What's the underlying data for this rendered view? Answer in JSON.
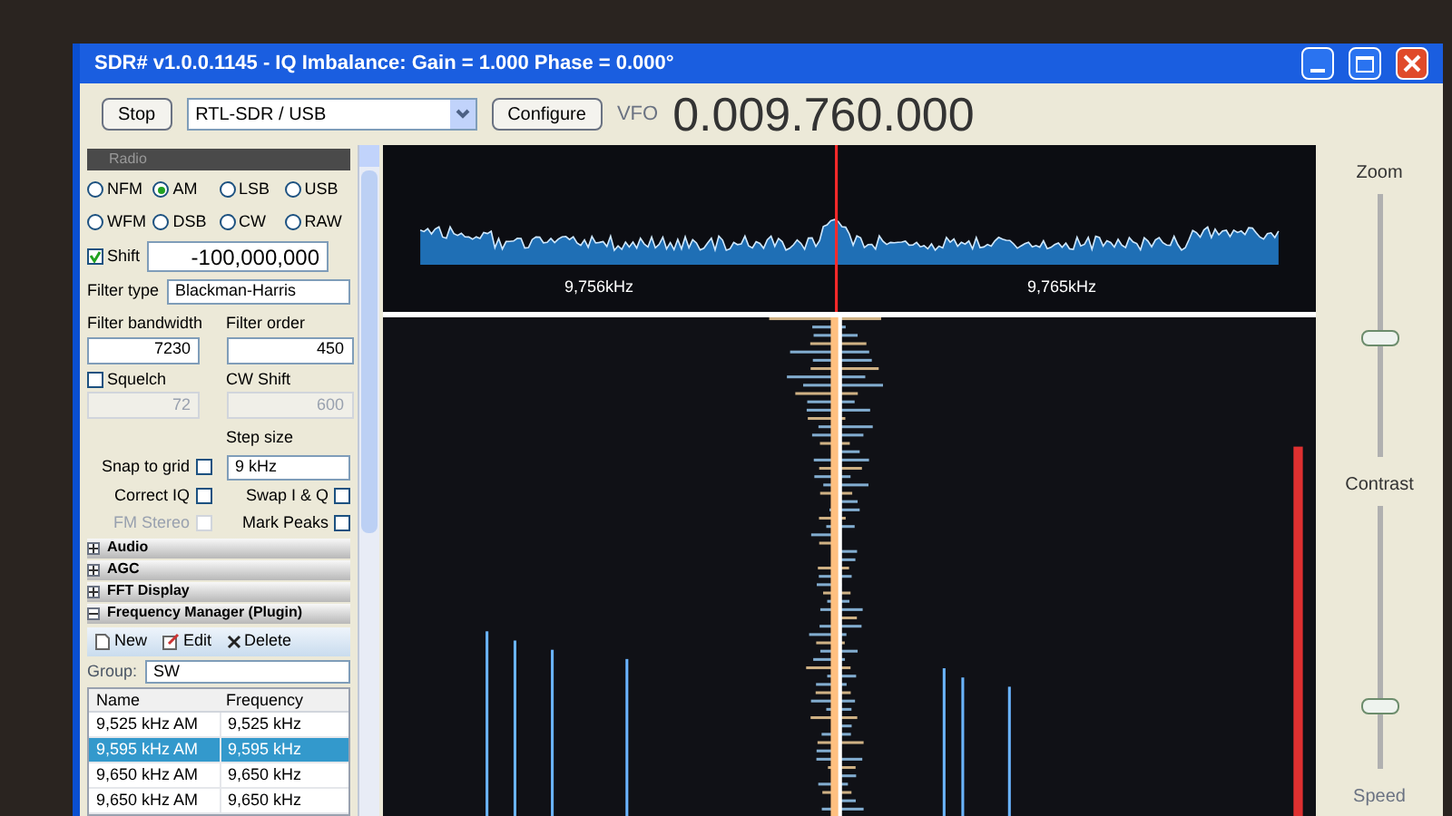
{
  "window": {
    "title": "SDR# v1.0.0.1145 - IQ Imbalance: Gain = 1.000 Phase = 0.000°"
  },
  "toolbar": {
    "start_stop": "Stop",
    "device": "RTL-SDR / USB",
    "configure": "Configure",
    "vfo_label": "VFO",
    "frequency": "0.009.760.000"
  },
  "radio": {
    "title": "Radio",
    "modes": [
      {
        "label": "NFM",
        "selected": false
      },
      {
        "label": "AM",
        "selected": true
      },
      {
        "label": "LSB",
        "selected": false
      },
      {
        "label": "USB",
        "selected": false
      },
      {
        "label": "WFM",
        "selected": false
      },
      {
        "label": "DSB",
        "selected": false
      },
      {
        "label": "CW",
        "selected": false
      },
      {
        "label": "RAW",
        "selected": false
      }
    ],
    "shift": {
      "label": "Shift",
      "checked": true,
      "value": "-100,000,000"
    },
    "filter_type": {
      "label": "Filter type",
      "value": "Blackman-Harris"
    },
    "filter_bandwidth": {
      "label": "Filter bandwidth",
      "value": "7230"
    },
    "filter_order": {
      "label": "Filter order",
      "value": "450"
    },
    "squelch": {
      "label": "Squelch",
      "checked": false,
      "value": "72"
    },
    "cw_shift": {
      "label": "CW Shift",
      "value": "600"
    },
    "step_size": {
      "label": "Step size",
      "value": "9 kHz"
    },
    "options": [
      {
        "label": "Snap to grid",
        "checked": false,
        "disabled": false
      },
      {
        "label": "Correct IQ",
        "checked": false,
        "disabled": false
      },
      {
        "label": "Swap I & Q",
        "checked": false,
        "disabled": false
      },
      {
        "label": "FM Stereo",
        "checked": false,
        "disabled": true
      },
      {
        "label": "Mark Peaks",
        "checked": false,
        "disabled": false
      }
    ]
  },
  "sections": [
    {
      "label": "Audio",
      "expanded": false
    },
    {
      "label": "AGC",
      "expanded": false
    },
    {
      "label": "FFT Display",
      "expanded": false
    },
    {
      "label": "Frequency Manager (Plugin)",
      "expanded": true
    }
  ],
  "frequency_manager": {
    "actions": [
      "New",
      "Edit",
      "Delete"
    ],
    "group_label": "Group:",
    "group": "SW",
    "columns": [
      "Name",
      "Frequency"
    ],
    "rows": [
      {
        "name": "9,525 kHz AM",
        "frequency": "9,525 kHz",
        "selected": false
      },
      {
        "name": "9,595 kHz AM",
        "frequency": "9,595 kHz",
        "selected": true
      },
      {
        "name": "9,650 kHz AM",
        "frequency": "9,650 kHz",
        "selected": false
      },
      {
        "name": "9,650 kHz AM",
        "frequency": "9,650 kHz",
        "selected": false
      }
    ]
  },
  "spectrum": {
    "freq_labels": [
      "9,756kHz",
      "9,765kHz"
    ]
  },
  "sliders": [
    {
      "label": "Zoom",
      "level": 0.45
    },
    {
      "label": "Contrast",
      "level": 0.22
    }
  ],
  "speed_label": "Speed"
}
